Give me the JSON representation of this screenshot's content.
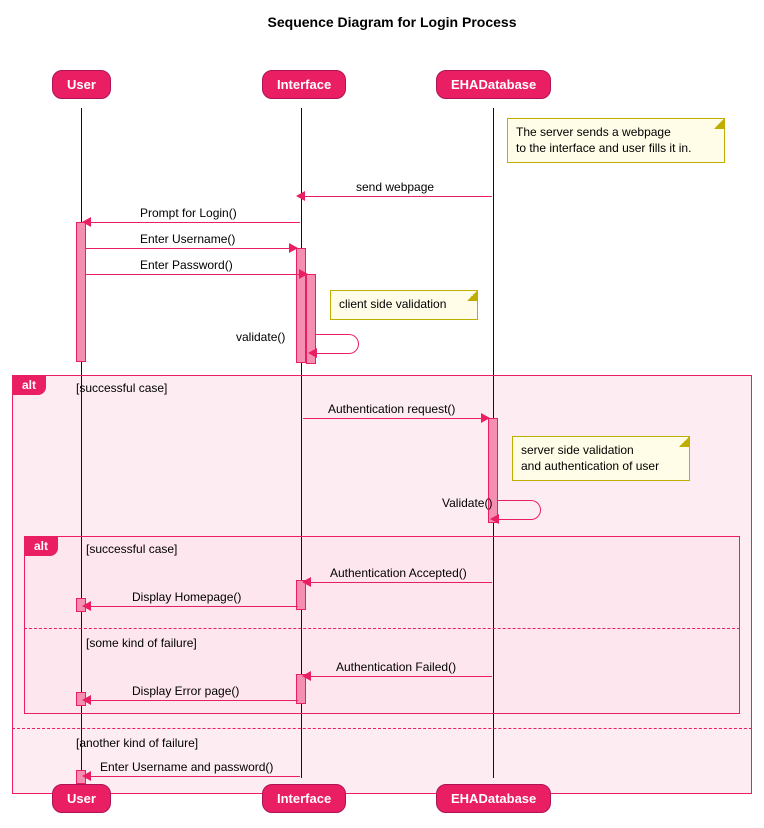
{
  "title": "Sequence Diagram for Login Process",
  "participants": {
    "user": "User",
    "interface": "Interface",
    "database": "EHADatabase"
  },
  "notes": {
    "n1_line1": "The server sends a webpage",
    "n1_line2": "to the interface and user fills it in.",
    "n2": "client side validation",
    "n3_line1": "server side validation",
    "n3_line2": "and authentication of user"
  },
  "messages": {
    "m1": "send webpage",
    "m2": "Prompt for Login()",
    "m3": "Enter Username()",
    "m4": "Enter Password()",
    "m5": "validate()",
    "m6": "Authentication request()",
    "m7": "Validate()",
    "m8": "Authentication Accepted()",
    "m9": "Display Homepage()",
    "m10": "Authentication Failed()",
    "m11": "Display Error page()",
    "m12": "Enter Username and password()"
  },
  "frames": {
    "alt": "alt",
    "guard1": "[successful case]",
    "guard2": "[successful case]",
    "guard3": "[some kind of failure]",
    "guard4": "[another kind of failure]"
  }
}
